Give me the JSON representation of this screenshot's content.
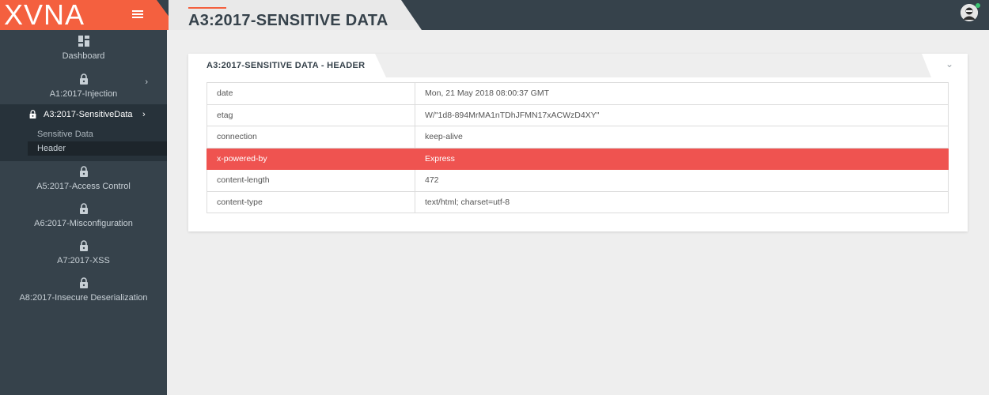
{
  "brand": {
    "logo": "XVNA",
    "accent_color": "#f4603f"
  },
  "header": {
    "title": "A3:2017-SENSITIVE DATA"
  },
  "sidebar": {
    "items": [
      {
        "label": "Dashboard",
        "icon": "dashboard-icon"
      },
      {
        "label": "A1:2017-Injection",
        "icon": "lock-icon"
      },
      {
        "label": "A3:2017-SensitiveData",
        "icon": "lock-icon",
        "active": true,
        "children": [
          {
            "label": "Sensitive Data"
          },
          {
            "label": "Header",
            "selected": true
          }
        ]
      },
      {
        "label": "A5:2017-Access Control",
        "icon": "lock-icon"
      },
      {
        "label": "A6:2017-Misconfiguration",
        "icon": "lock-icon"
      },
      {
        "label": "A7:2017-XSS",
        "icon": "lock-icon"
      },
      {
        "label": "A8:2017-Insecure Deserialization",
        "icon": "lock-icon"
      }
    ]
  },
  "card": {
    "title": "A3:2017-SENSITIVE DATA - HEADER",
    "rows": [
      {
        "key": "date",
        "value": "Mon, 21 May 2018 08:00:37 GMT"
      },
      {
        "key": "etag",
        "value": "W/\"1d8-894MrMA1nTDhJFMN17xACWzD4XY\""
      },
      {
        "key": "connection",
        "value": "keep-alive"
      },
      {
        "key": "x-powered-by",
        "value": "Express",
        "highlight": true
      },
      {
        "key": "content-length",
        "value": "472"
      },
      {
        "key": "content-type",
        "value": "text/html; charset=utf-8"
      }
    ],
    "highlight_color": "#ef5350"
  }
}
